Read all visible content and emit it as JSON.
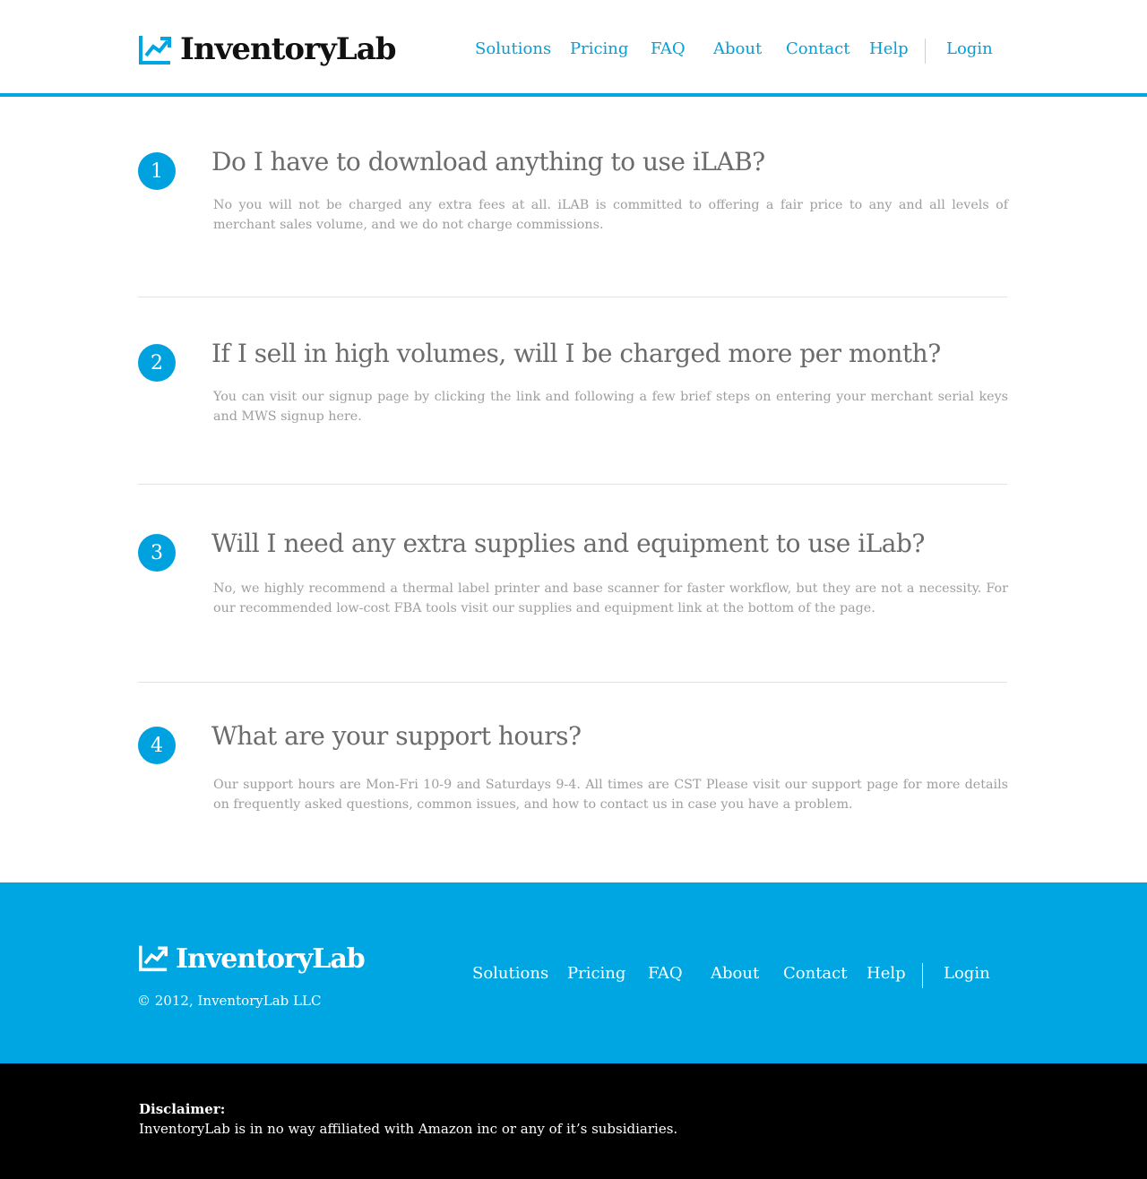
{
  "brand": {
    "name": "InventoryLab",
    "color_primary": "#00a6e1",
    "logo_icon": "trend-chart-icon"
  },
  "nav": {
    "items": [
      "Solutions",
      "Pricing",
      "FAQ",
      "About",
      "Contact",
      "Help"
    ],
    "login": "Login"
  },
  "faq": [
    {
      "number": "1",
      "question": "Do I have to download anything to use iLAB?",
      "answer": "No you will not be charged any extra fees at all. iLAB is committed to offering a fair price to any and all levels of merchant sales volume, and we do not charge commissions."
    },
    {
      "number": "2",
      "question": "If I sell in high volumes, will I be charged more per month?",
      "answer": "You can visit our signup page by clicking the link and following a few brief steps on entering your merchant serial keys and MWS signup here."
    },
    {
      "number": "3",
      "question": "Will I need any extra supplies and equipment to use iLab?",
      "answer": "No, we highly recommend a thermal label printer and base scanner for faster workflow, but they are not a necessity. For our recommended low-cost FBA tools visit our supplies and equipment link at the bottom of the page."
    },
    {
      "number": "4",
      "question": "What are your support hours?",
      "answer": "Our support hours are Mon-Fri 10-9 and Saturdays 9-4. All times are CST Please visit our support page for more details on frequently asked questions, common issues, and how to contact us in case you have a problem."
    }
  ],
  "footer": {
    "copyright": "© 2012, InventoryLab LLC"
  },
  "disclaimer": {
    "title": "Disclaimer:",
    "text": "InventoryLab is in no way affiliated with Amazon inc or any of it’s subsidiaries."
  }
}
